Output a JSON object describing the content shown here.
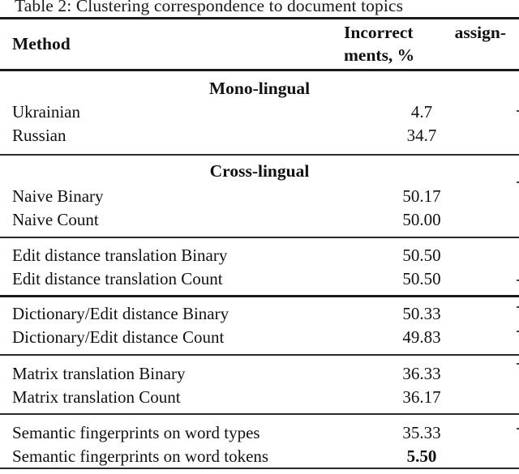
{
  "caption": "Table 2: Clustering correspondence to document topics",
  "table": {
    "headers": {
      "method": "Method",
      "value_line1_a": "Incorrect",
      "value_line1_b": "assign-",
      "value_line2": "ments, %"
    },
    "sections": [
      {
        "title": "Mono-lingual",
        "rows": [
          {
            "method": "Ukrainian",
            "value": "4.7"
          },
          {
            "method": "Russian",
            "value": "34.7"
          }
        ]
      },
      {
        "title": "Cross-lingual",
        "rows": [
          {
            "method": "Naive Binary",
            "value": "50.17"
          },
          {
            "method": "Naive Count",
            "value": "50.00"
          }
        ]
      },
      {
        "title": "",
        "rows": [
          {
            "method": "Edit distance translation Binary",
            "value": "50.50"
          },
          {
            "method": "Edit distance translation Count",
            "value": "50.50"
          }
        ]
      },
      {
        "title": "",
        "rows": [
          {
            "method": "Dictionary/Edit distance Binary",
            "value": "50.33"
          },
          {
            "method": "Dictionary/Edit distance Count",
            "value": "49.83"
          }
        ]
      },
      {
        "title": "",
        "rows": [
          {
            "method": "Matrix translation Binary",
            "value": "36.33"
          },
          {
            "method": "Matrix translation Count",
            "value": "36.17"
          }
        ]
      },
      {
        "title": "",
        "rows": [
          {
            "method": "Semantic fingerprints on word types",
            "value": "35.33"
          },
          {
            "method": "Semantic fingerprints on word tokens",
            "value": "5.50",
            "bold": true
          }
        ]
      }
    ]
  }
}
